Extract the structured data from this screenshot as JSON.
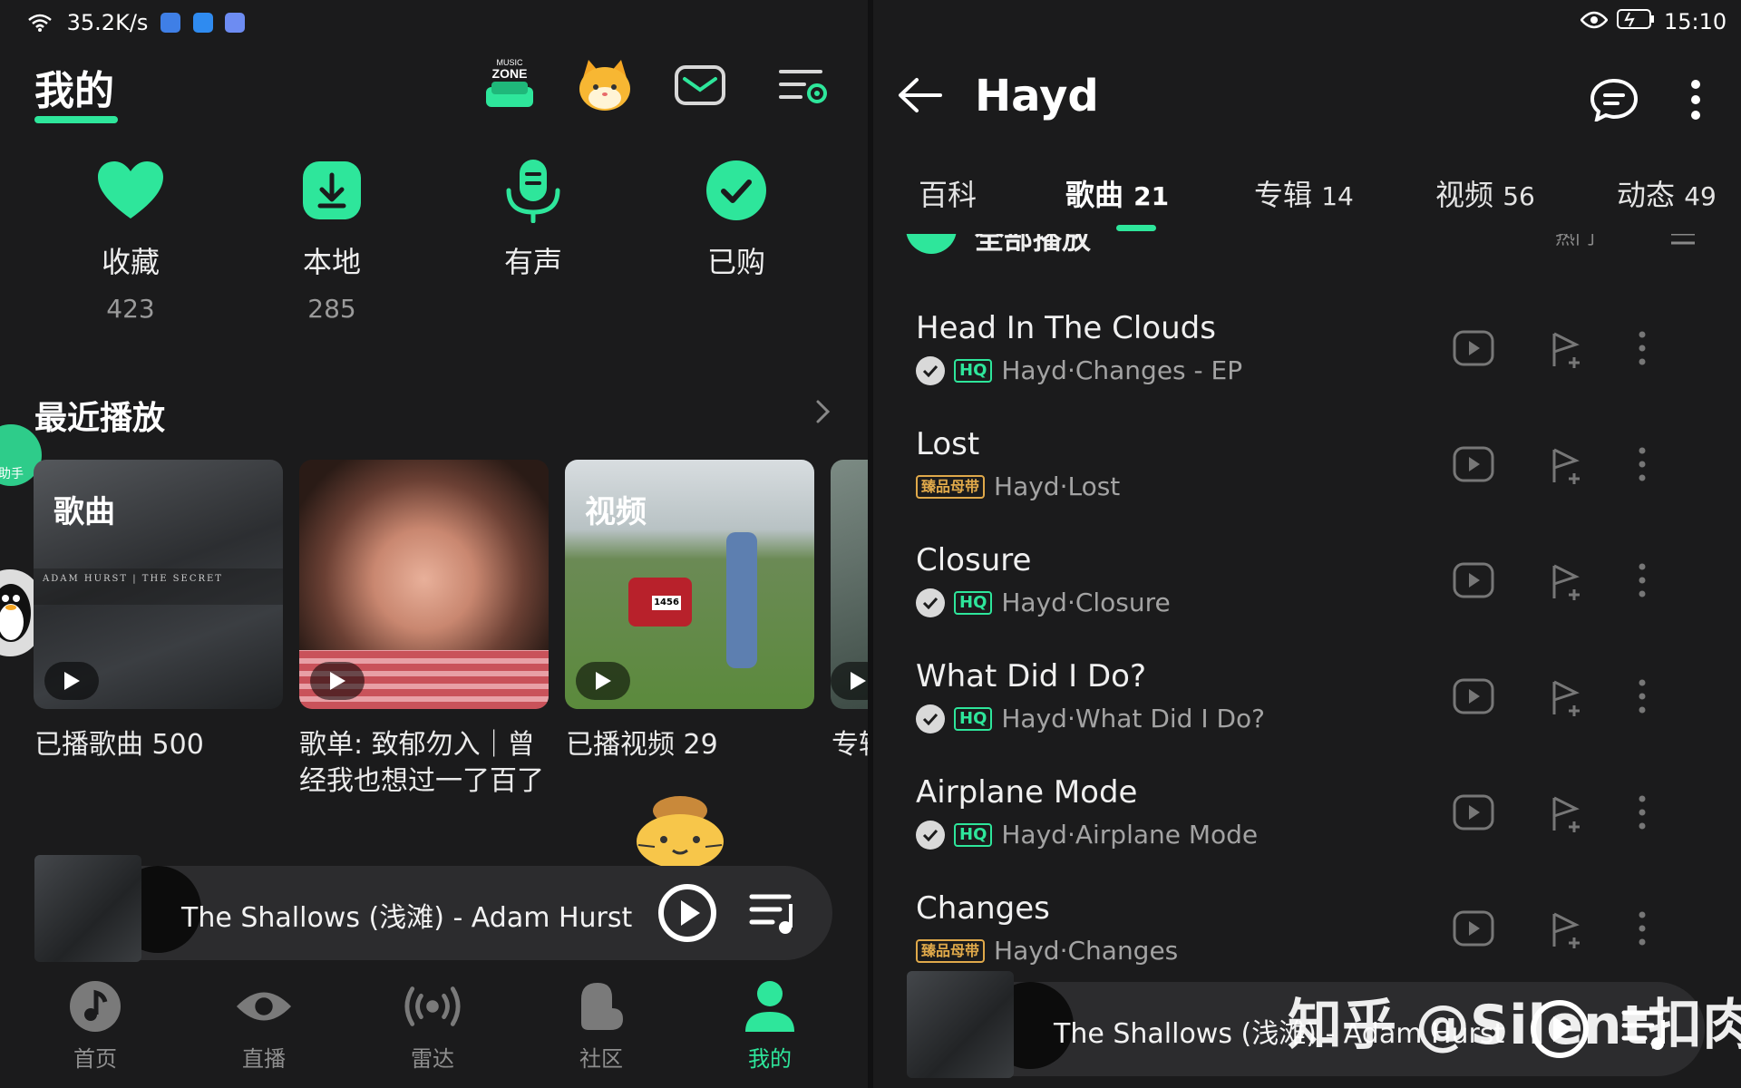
{
  "left": {
    "status": {
      "speed": "35.2K/s"
    },
    "header": {
      "title": "我的",
      "music_zone_line1": "MUSIC",
      "music_zone_line2": "ZONE",
      "icons": [
        "music-zone-icon",
        "cat-avatar-icon",
        "mail-icon",
        "playlist-settings-icon"
      ]
    },
    "quick": [
      {
        "label": "收藏",
        "count": "423"
      },
      {
        "label": "本地",
        "count": "285"
      },
      {
        "label": "有声",
        "count": ""
      },
      {
        "label": "已购",
        "count": ""
      }
    ],
    "recent": {
      "title": "最近播放",
      "cards": [
        {
          "tag": "歌曲",
          "caption": "已播歌曲 500",
          "art_text": "ADAM HURST | THE SECRET"
        },
        {
          "tag": "",
          "caption": "歌单: 致郁勿入｜曾经我也想过一了百了"
        },
        {
          "tag": "视频",
          "caption": "已播视频 29",
          "plate": "1456"
        },
        {
          "tag": "",
          "caption": "专辑"
        }
      ]
    },
    "floating": {
      "assistant_label": "助手"
    },
    "player": {
      "song": "The Shallows (浅滩) - Adam Hurst"
    },
    "nav": [
      {
        "label": "首页"
      },
      {
        "label": "直播"
      },
      {
        "label": "雷达"
      },
      {
        "label": "社区"
      },
      {
        "label": "我的"
      }
    ],
    "accent": "#2ee69b"
  },
  "right": {
    "status": {
      "time": "15:10"
    },
    "header": {
      "artist": "Hayd"
    },
    "tabs": [
      {
        "label": "百科",
        "count": ""
      },
      {
        "label": "歌曲",
        "count": "21"
      },
      {
        "label": "专辑",
        "count": "14"
      },
      {
        "label": "视频",
        "count": "56"
      },
      {
        "label": "动态",
        "count": "49"
      }
    ],
    "play_all": {
      "label": "全部播放",
      "sort": "热门"
    },
    "songs": [
      {
        "title": "Head In The Clouds",
        "badge": "HQ",
        "downloaded": true,
        "artist": "Hayd",
        "album": "Changes - EP"
      },
      {
        "title": "Lost",
        "badge": "臻品母带",
        "downloaded": false,
        "artist": "Hayd",
        "album": "Lost"
      },
      {
        "title": "Closure",
        "badge": "HQ",
        "downloaded": true,
        "artist": "Hayd",
        "album": "Closure"
      },
      {
        "title": "What Did I Do?",
        "badge": "HQ",
        "downloaded": true,
        "artist": "Hayd",
        "album": "What Did I Do?"
      },
      {
        "title": "Airplane Mode",
        "badge": "HQ",
        "downloaded": true,
        "artist": "Hayd",
        "album": "Airplane Mode"
      },
      {
        "title": "Changes",
        "badge": "臻品母带",
        "downloaded": false,
        "artist": "Hayd",
        "album": "Changes"
      }
    ],
    "separator": "·",
    "player": {
      "song": "The Shallows (浅滩) - Adam Hurst"
    },
    "watermark": "知乎 @Silent扣肉"
  }
}
